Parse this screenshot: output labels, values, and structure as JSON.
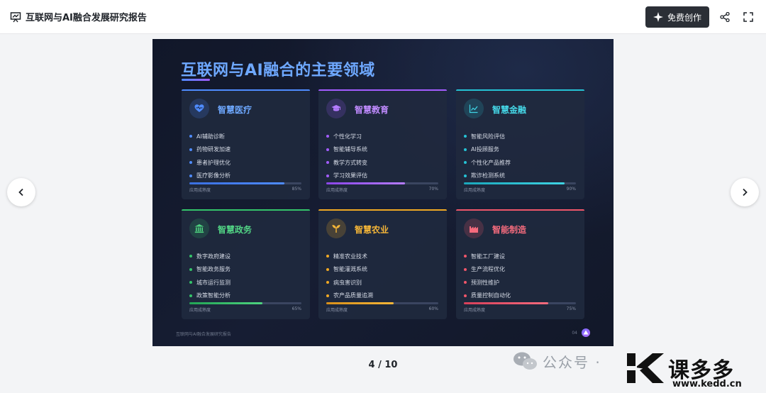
{
  "header": {
    "title": "互联网与AI融合发展研究报告",
    "create_label": "免费创作"
  },
  "slide": {
    "title": "互联网与AI融合的主要领域",
    "progress_label": "应用成熟度",
    "footer_text": "互联网与AI融合发展研究报告",
    "page_no": "04",
    "cards": [
      {
        "title": "智慧医疗",
        "color": "#4f8cff",
        "icon": "heart-icon",
        "items": [
          "AI辅助诊断",
          "药物研发加速",
          "患者护理优化",
          "医疗影像分析"
        ],
        "maturity": 85,
        "maturity_label": "85%"
      },
      {
        "title": "智慧教育",
        "color": "#a35cff",
        "icon": "graduation-cap-icon",
        "items": [
          "个性化学习",
          "智能辅导系统",
          "教学方式转变",
          "学习效果评估"
        ],
        "maturity": 70,
        "maturity_label": "70%"
      },
      {
        "title": "智慧金融",
        "color": "#25c2d4",
        "icon": "line-chart-icon",
        "items": [
          "智能风险评估",
          "AI投顾服务",
          "个性化产品推荐",
          "欺诈检测系统"
        ],
        "maturity": 90,
        "maturity_label": "90%"
      },
      {
        "title": "智慧政务",
        "color": "#34c46a",
        "icon": "landmark-icon",
        "items": [
          "数字政府建设",
          "智能政务服务",
          "城市运行监测",
          "政策智能分析"
        ],
        "maturity": 65,
        "maturity_label": "65%"
      },
      {
        "title": "智慧农业",
        "color": "#f0a824",
        "icon": "seedling-icon",
        "items": [
          "精准农业技术",
          "智能灌溉系统",
          "病虫害识别",
          "农产品质量追溯"
        ],
        "maturity": 60,
        "maturity_label": "60%"
      },
      {
        "title": "智能制造",
        "color": "#f0566a",
        "icon": "factory-icon",
        "items": [
          "智能工厂建设",
          "生产流程优化",
          "预测性维护",
          "质量控制自动化"
        ],
        "maturity": 75,
        "maturity_label": "75%"
      }
    ]
  },
  "pager": {
    "text": "4 / 10"
  },
  "watermark": {
    "wechat_text": "公众号 ·",
    "brand": "课多多",
    "url": "www.kedd.cn"
  }
}
